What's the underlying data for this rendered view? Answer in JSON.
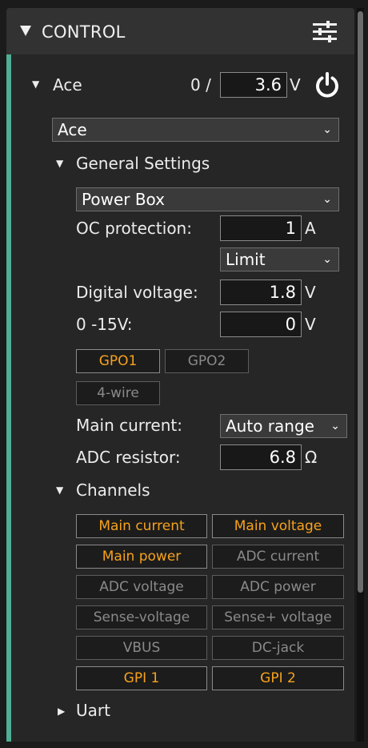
{
  "header": {
    "title": "CONTROL",
    "collapse_icon": "triangle-down-icon",
    "settings_icon": "sliders-icon"
  },
  "device": {
    "name": "Ace",
    "voltage_prefix": "0 /",
    "voltage_value": "3.6",
    "voltage_unit": "V",
    "power_icon": "power-icon",
    "select_value": "Ace"
  },
  "general": {
    "title": "General Settings",
    "mode_select": "Power Box",
    "oc_label": "OC protection:",
    "oc_value": "1",
    "oc_unit": "A",
    "oc_mode_select": "Limit",
    "digital_label": "Digital voltage:",
    "digital_value": "1.8",
    "digital_unit": "V",
    "range_label": "0 -15V:",
    "range_value": "0",
    "range_unit": "V",
    "gpo1": "GPO1",
    "gpo2": "GPO2",
    "four_wire": "4-wire",
    "main_current_label": "Main current:",
    "main_current_select": "Auto range",
    "adc_label": "ADC resistor:",
    "adc_value": "6.8",
    "adc_unit": "Ω"
  },
  "channels": {
    "title": "Channels",
    "items": [
      {
        "label": "Main current",
        "active": true
      },
      {
        "label": "Main voltage",
        "active": true
      },
      {
        "label": "Main power",
        "active": true
      },
      {
        "label": "ADC current",
        "active": false
      },
      {
        "label": "ADC voltage",
        "active": false
      },
      {
        "label": "ADC power",
        "active": false
      },
      {
        "label": "Sense-voltage",
        "active": false
      },
      {
        "label": "Sense+ voltage",
        "active": false
      },
      {
        "label": "VBUS",
        "active": false
      },
      {
        "label": "DC-jack",
        "active": false
      },
      {
        "label": "GPI 1",
        "active": true
      },
      {
        "label": "GPI 2",
        "active": true
      }
    ]
  },
  "uart": {
    "title": "Uart"
  },
  "colors": {
    "accent": "#4fae95",
    "active_text": "#f7a21c",
    "inactive_text": "#8a8a8a",
    "background": "#262626"
  }
}
